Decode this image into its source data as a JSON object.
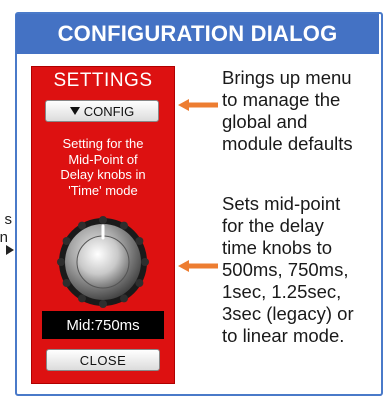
{
  "dialog_title": "CONFIGURATION DIALOG",
  "left_cut": {
    "lines": [
      "s",
      "n"
    ]
  },
  "panel": {
    "title": "SETTINGS",
    "config_button": "CONFIG",
    "description_lines": [
      "Setting for the",
      "Mid-Point of",
      "Delay knobs in",
      "'Time' mode"
    ],
    "readout": "Mid:750ms",
    "close_button": "CLOSE"
  },
  "callouts": {
    "config": [
      "Brings up menu",
      "to manage the",
      "global and",
      "module defaults"
    ],
    "knob": [
      "Sets mid-point",
      "for the delay",
      "time knobs to",
      "500ms, 750ms,",
      "1sec, 1.25sec,",
      "3sec (legacy) or",
      "to linear mode."
    ]
  },
  "colors": {
    "title_bar": "#4472c4",
    "panel_red": "#dd1111",
    "arrow_orange": "#ed7d31"
  },
  "icons": {
    "config_caret": "caret-down-icon",
    "knob": "rotary-knob-icon",
    "arrows": "arrow-left-icon"
  }
}
